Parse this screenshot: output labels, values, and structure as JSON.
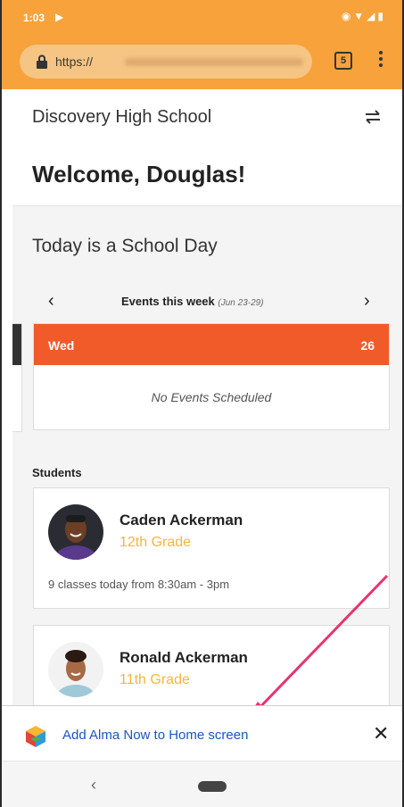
{
  "status_bar": {
    "time": "1:03"
  },
  "browser": {
    "url_prefix": "https://",
    "tab_count": "5"
  },
  "header": {
    "school_name": "Discovery High School",
    "welcome": "Welcome, Douglas!"
  },
  "today": {
    "text": "Today is a School Day"
  },
  "events": {
    "title": "Events this week",
    "range": "(Jun 23-29)",
    "day_name": "Wed",
    "day_number": "26",
    "empty_text": "No Events Scheduled",
    "header_color": "#f15a29"
  },
  "students": {
    "label": "Students",
    "items": [
      {
        "name": "Caden Ackerman",
        "grade": "12th Grade",
        "classes": "9 classes today from 8:30am - 3pm"
      },
      {
        "name": "Ronald Ackerman",
        "grade": "11th Grade"
      }
    ]
  },
  "add_to_home": {
    "text": "Add Alma Now to Home screen"
  },
  "colors": {
    "toolbar": "#f7a23a",
    "accent_grade": "#f5b542",
    "link": "#1a55c4",
    "arrow": "#e8336f"
  }
}
